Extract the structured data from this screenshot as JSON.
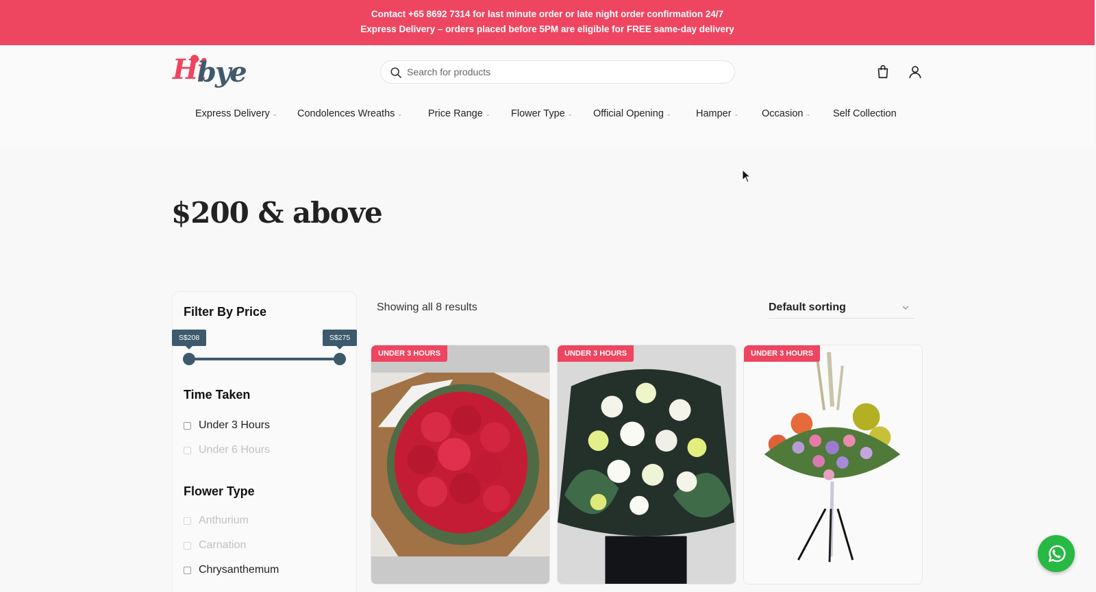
{
  "topbar": {
    "line1": "Contact +65 8692 7314 for last minute order or late night order confirmation 24/7",
    "line2": "Express Delivery – orders placed before 5PM are eligible for FREE same-day delivery"
  },
  "brand": {
    "logo_hi": "Hi",
    "logo_bye": "bye"
  },
  "search": {
    "placeholder": "Search for products",
    "value": ""
  },
  "header_icons": [
    "cart-icon",
    "user-icon"
  ],
  "nav": [
    {
      "label": "Express Delivery",
      "dropdown": true
    },
    {
      "label": "Condolences Wreaths",
      "dropdown": true
    },
    {
      "label": "Price Range",
      "dropdown": true
    },
    {
      "label": "Flower Type",
      "dropdown": true
    },
    {
      "label": "Official Opening",
      "dropdown": true
    },
    {
      "label": "Hamper",
      "dropdown": true
    },
    {
      "label": "Occasion",
      "dropdown": true
    },
    {
      "label": "Self Collection",
      "dropdown": false
    }
  ],
  "page": {
    "title": "$200 & above"
  },
  "sidebar": {
    "price": {
      "heading": "Filter By Price",
      "min_label": "S$208",
      "max_label": "S$275",
      "min": 208,
      "max": 275
    },
    "time": {
      "heading": "Time Taken",
      "options": [
        {
          "label": "Under 3 Hours",
          "enabled": true,
          "checked": false
        },
        {
          "label": "Under 6 Hours",
          "enabled": false,
          "checked": false
        }
      ]
    },
    "flower": {
      "heading": "Flower Type",
      "options": [
        {
          "label": "Anthurium",
          "enabled": false,
          "checked": false
        },
        {
          "label": "Carnation",
          "enabled": false,
          "checked": false
        },
        {
          "label": "Chrysanthemum",
          "enabled": true,
          "checked": false
        }
      ]
    }
  },
  "toolbar": {
    "results_text": "Showing all 8 results",
    "sort_label": "Default sorting"
  },
  "products": [
    {
      "badge": "UNDER 3 HOURS",
      "image": "red-roses-bouquet"
    },
    {
      "badge": "UNDER 3 HOURS",
      "image": "white-lily-arrangement"
    },
    {
      "badge": "UNDER 3 HOURS",
      "image": "flower-stand-with-balloons"
    }
  ],
  "colors": {
    "accent": "#ee4560",
    "slate": "#3d5a6c",
    "whatsapp": "#28b844"
  }
}
